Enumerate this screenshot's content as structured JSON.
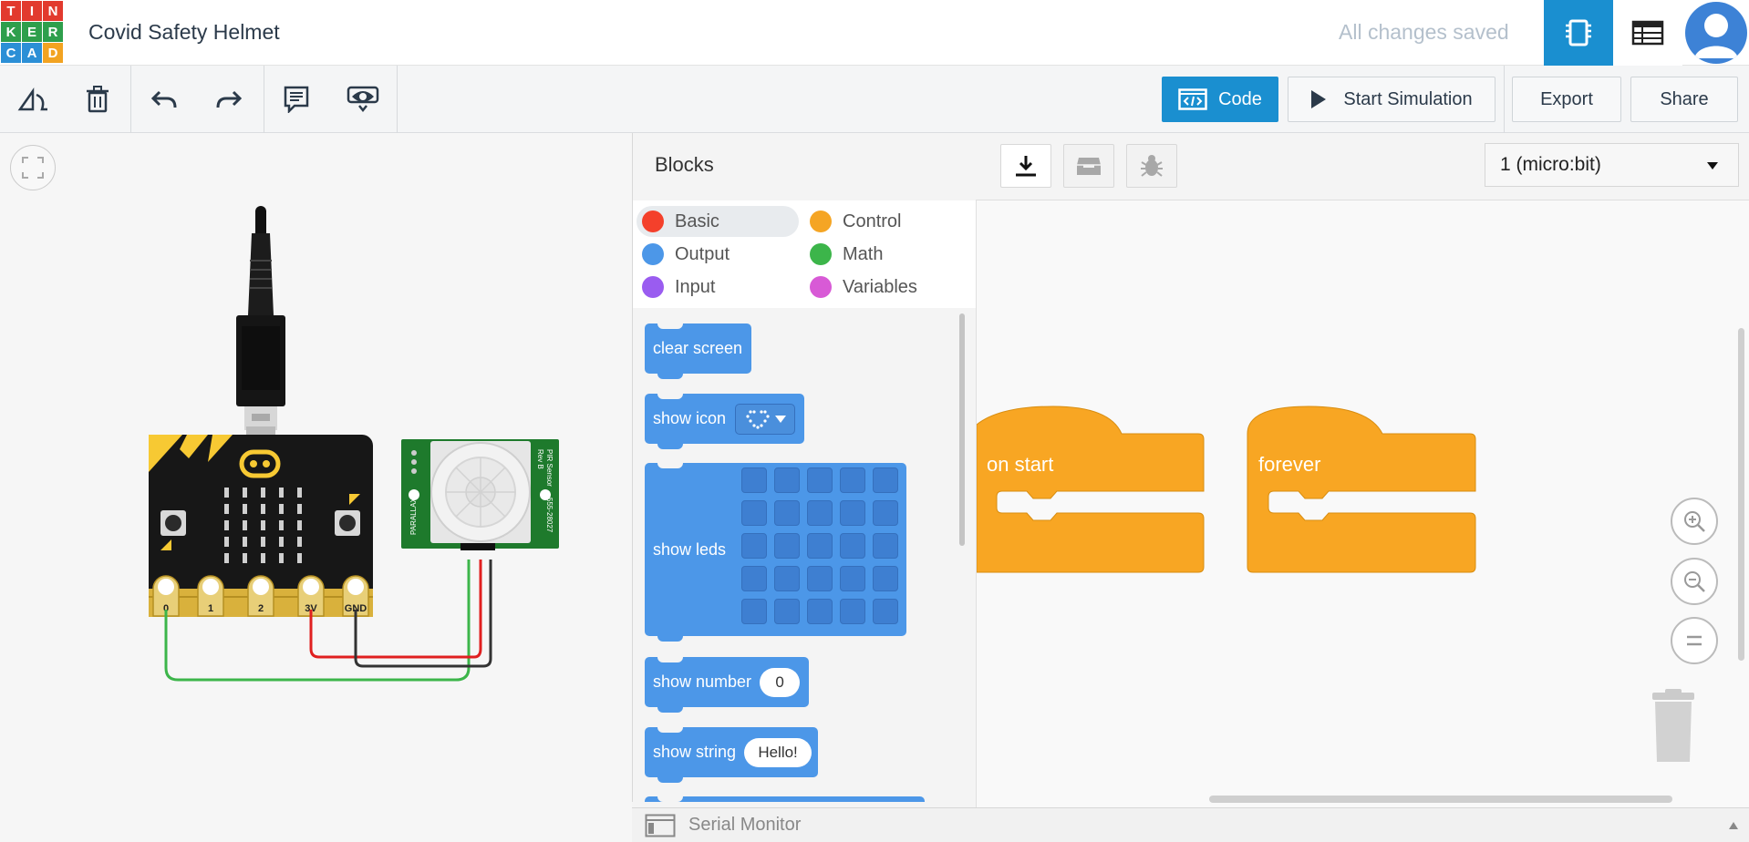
{
  "app": {
    "logo_letters": [
      "T",
      "I",
      "N",
      "K",
      "E",
      "R",
      "C",
      "A",
      "D"
    ],
    "logo_colors": [
      "#e23a2e",
      "#e23a2e",
      "#e23a2e",
      "#2e9f4c",
      "#2e9f4c",
      "#2e9f4c",
      "#2b8fd6",
      "#2b8fd6",
      "#f2a321"
    ],
    "project_title": "Covid Safety Helmet",
    "save_status": "All changes saved"
  },
  "toolbar": {
    "code_label": "Code",
    "start_sim_label": "Start Simulation",
    "export_label": "Export",
    "share_label": "Share",
    "accent": "#1a8fd0"
  },
  "blocks": {
    "title": "Blocks",
    "categories": [
      {
        "label": "Basic",
        "color": "#f4402b",
        "selected": true
      },
      {
        "label": "Control",
        "color": "#f5a524",
        "selected": false
      },
      {
        "label": "Output",
        "color": "#4c97e8",
        "selected": false
      },
      {
        "label": "Math",
        "color": "#3cb54a",
        "selected": false
      },
      {
        "label": "Input",
        "color": "#9a5cf0",
        "selected": false
      },
      {
        "label": "Variables",
        "color": "#d85ad6",
        "selected": false
      }
    ],
    "palette": {
      "clear_screen": "clear screen",
      "show_icon": "show icon",
      "show_leds": "show leds",
      "show_number": "show number",
      "show_number_value": "0",
      "show_string": "show string",
      "show_string_value": "Hello!"
    }
  },
  "workspace": {
    "device": "1 (micro:bit)",
    "on_start_label": "on start",
    "forever_label": "forever",
    "hat_color": "#f8a623"
  },
  "circuit": {
    "pin_labels": [
      "0",
      "1",
      "2",
      "3V",
      "GND"
    ],
    "sensor_brand": "PARALLAX",
    "sensor_name": "PIR Sensor",
    "sensor_rev": "Rev B",
    "sensor_part": "555-28027"
  },
  "serial_monitor": {
    "label": "Serial Monitor"
  }
}
